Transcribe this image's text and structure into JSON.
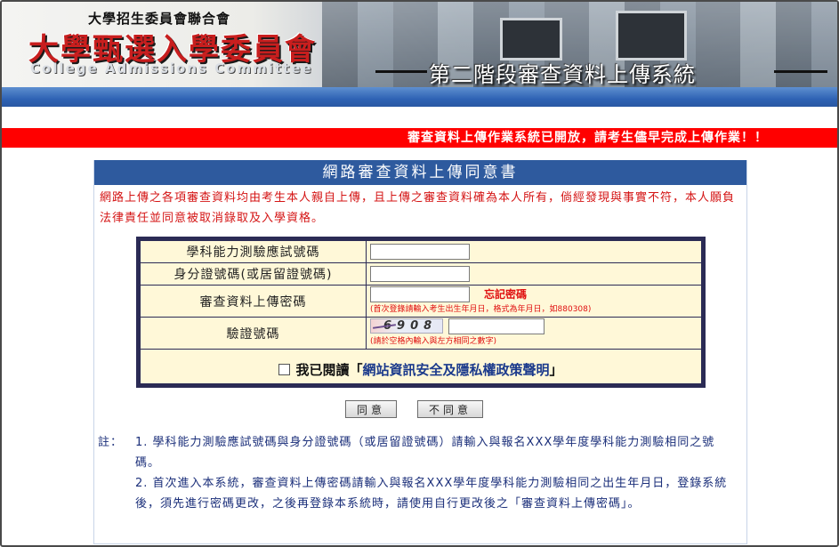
{
  "header": {
    "org_small": "大學招生委員會聯合會",
    "org_big": "大學甄選入學委員會",
    "org_en": "College Admissions Committee",
    "system_title": "第二階段審查資料上傳系統"
  },
  "notice": "審查資料上傳作業系統已開放，請考生儘早完成上傳作業！！",
  "panel": {
    "title": "網路審查資料上傳同意書",
    "intro": "網路上傳之各項審查資料均由考生本人親自上傳，且上傳之審查資料確為本人所有，倘經發現與事實不符，本人願負法律責任並同意被取消錄取及入學資格。"
  },
  "form": {
    "exam_id_label": "學科能力測驗應試號碼",
    "id_label": "身分證號碼(或居留證號碼)",
    "password_label": "審查資料上傳密碼",
    "forgot_password": "忘記密碼",
    "password_hint": "(首次登錄請輸入考生出生年月日，格式為年月日，如880308)",
    "captcha_label": "驗證號碼",
    "captcha_value": "6908",
    "captcha_hint": "(請於空格內輸入與左方相同之數字)",
    "agree_prefix": "我已閱讀「",
    "agree_link": "網站資訊安全及隱私權政策聲明",
    "agree_suffix": "」"
  },
  "buttons": {
    "agree": "同意",
    "disagree": "不同意"
  },
  "notes": {
    "prefix": "註：",
    "items": [
      "1. 學科能力測驗應試號碼與身分證號碼（或居留證號碼）請輸入與報名XXX學年度學科能力測驗相同之號碼。",
      "2. 首次進入本系統，審查資料上傳密碼請輸入與報名XXX學年度學科能力測驗相同之出生年月日，登錄系統後，須先進行密碼更改，之後再登錄本系統時，請使用自行更改後之「審查資料上傳密碼」。"
    ]
  },
  "colors": {
    "notice_bg": "#ff0000",
    "panel_header": "#2e5a9e",
    "form_bg": "#fff8d8",
    "intro_text": "#d41414",
    "notes_text": "#1b2f7a"
  }
}
